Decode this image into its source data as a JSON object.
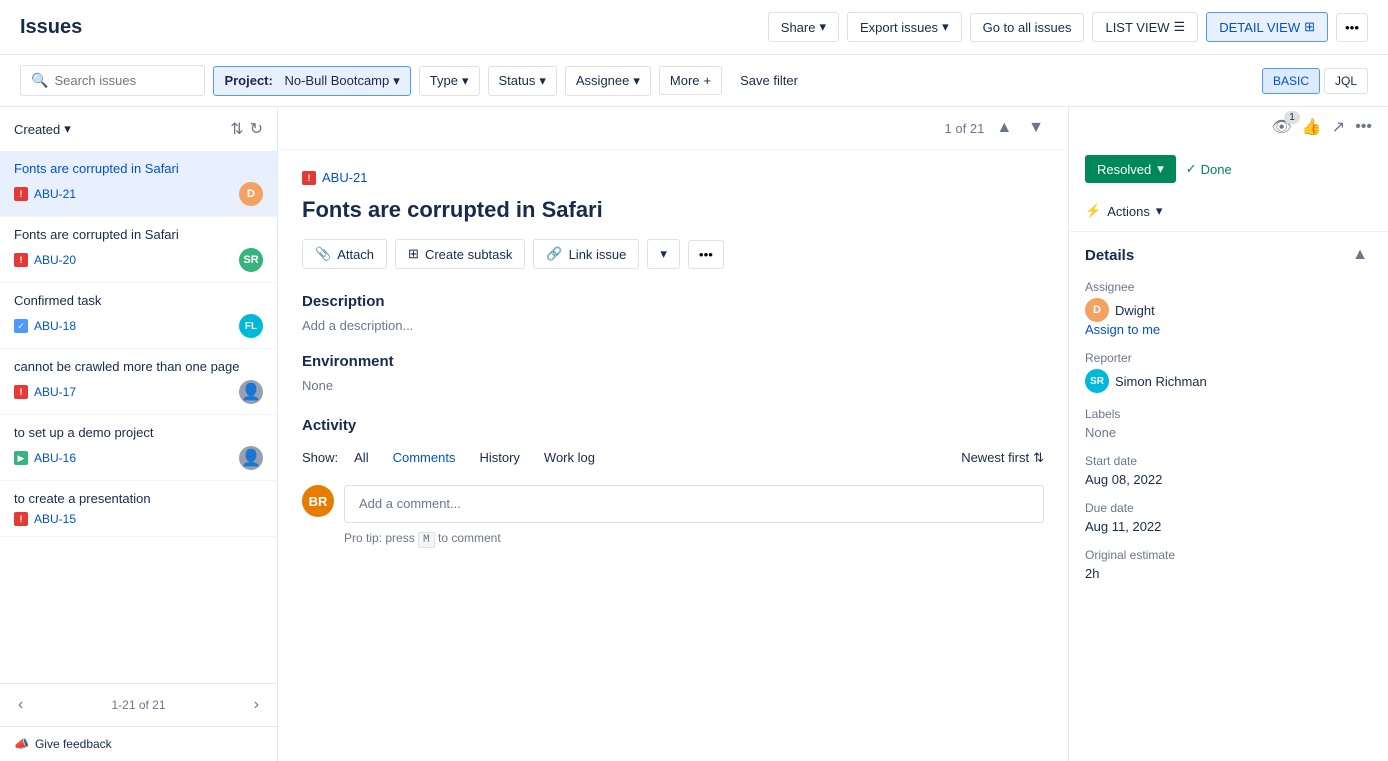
{
  "header": {
    "title": "Issues",
    "share_label": "Share",
    "export_label": "Export issues",
    "goto_label": "Go to all issues",
    "list_view_label": "LIST VIEW",
    "detail_view_label": "DETAIL VIEW",
    "more_dots": "..."
  },
  "filter_bar": {
    "search_placeholder": "Search issues",
    "project_label": "Project:",
    "project_value": "No-Bull Bootcamp",
    "type_label": "Type",
    "status_label": "Status",
    "assignee_label": "Assignee",
    "more_label": "More",
    "save_filter_label": "Save filter",
    "basic_label": "BASIC",
    "jql_label": "JQL"
  },
  "sidebar": {
    "sort_label": "Created",
    "pagination": "1-21 of 21",
    "feedback_label": "Give feedback",
    "issues": [
      {
        "id": "ABU-21",
        "title": "Fonts are corrupted in Safari",
        "type": "bug",
        "avatar_initials": "D",
        "avatar_color": "orange",
        "active": true,
        "title_linked": true
      },
      {
        "id": "ABU-20",
        "title": "Fonts are corrupted in Safari",
        "type": "bug",
        "avatar_initials": "SR",
        "avatar_color": "green",
        "active": false,
        "title_linked": false
      },
      {
        "id": "ABU-18",
        "title": "Confirmed task",
        "type": "task",
        "avatar_initials": "FL",
        "avatar_color": "teal",
        "active": false,
        "title_linked": false
      },
      {
        "id": "ABU-17",
        "title": "cannot be crawled more than one page",
        "type": "bug",
        "avatar_initials": "",
        "avatar_color": "gray",
        "active": false,
        "title_linked": false
      },
      {
        "id": "ABU-16",
        "title": "to set up a demo project",
        "type": "story",
        "avatar_initials": "",
        "avatar_color": "gray",
        "active": false,
        "title_linked": false
      },
      {
        "id": "ABU-15",
        "title": "to create a presentation",
        "type": "bug",
        "avatar_initials": "",
        "avatar_color": "gray",
        "active": false,
        "title_linked": false
      }
    ]
  },
  "detail": {
    "ref": "ABU-21",
    "title": "Fonts are corrupted in Safari",
    "nav_count": "1 of 21",
    "attach_label": "Attach",
    "create_subtask_label": "Create subtask",
    "link_issue_label": "Link issue",
    "description_title": "Description",
    "description_placeholder": "Add a description...",
    "environment_title": "Environment",
    "environment_value": "None",
    "activity_title": "Activity",
    "show_label": "Show:",
    "show_all": "All",
    "show_comments": "Comments",
    "show_history": "History",
    "show_worklog": "Work log",
    "sort_label": "Newest first",
    "comment_placeholder": "Add a comment...",
    "pro_tip": "Pro tip: press",
    "pro_tip_key": "M",
    "pro_tip_suffix": "to comment",
    "comment_avatar": "BR"
  },
  "right_panel": {
    "watch_count": "1",
    "resolved_label": "Resolved",
    "done_label": "Done",
    "actions_label": "Actions",
    "details_title": "Details",
    "assignee_label": "Assignee",
    "assignee_name": "Dwight",
    "assignee_avatar": "D",
    "assignee_avatar_color": "#f4a261",
    "assign_me_label": "Assign to me",
    "reporter_label": "Reporter",
    "reporter_name": "Simon Richman",
    "reporter_avatar": "SR",
    "reporter_avatar_color": "#00b8d9",
    "labels_label": "Labels",
    "labels_value": "None",
    "start_date_label": "Start date",
    "start_date_value": "Aug 08, 2022",
    "due_date_label": "Due date",
    "due_date_value": "Aug 11, 2022",
    "original_estimate_label": "Original estimate",
    "original_estimate_value": "2h"
  }
}
